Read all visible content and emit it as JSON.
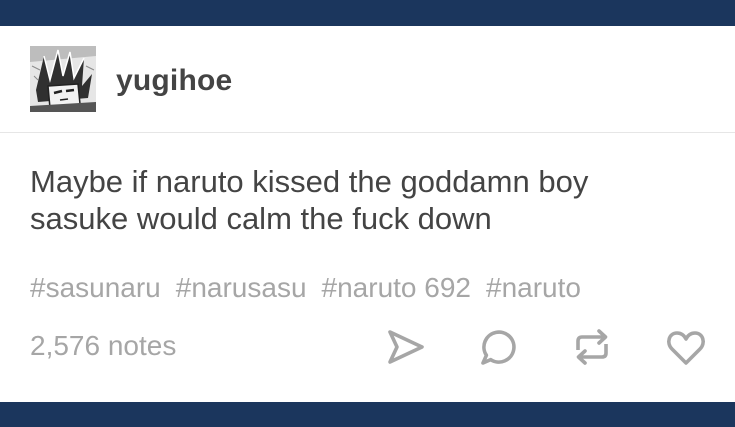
{
  "post": {
    "username": "yugihoe",
    "avatar_icon": "manga-avatar-icon",
    "body_lines": [
      "Maybe if naruto kissed the goddamn boy",
      "sasuke would calm the fuck down"
    ],
    "tags": [
      "#sasunaru",
      "#narusasu",
      "#naruto 692",
      "#naruto"
    ],
    "notes": "2,576 notes"
  },
  "actions": {
    "icons": [
      "share-icon",
      "reply-icon",
      "reblog-icon",
      "like-icon"
    ]
  },
  "colors": {
    "nav_bar": "#1b365d",
    "card_background": "#ffffff",
    "body_text": "#444444",
    "meta_text": "#a6a6a6",
    "icon": "#a6a6a6"
  }
}
